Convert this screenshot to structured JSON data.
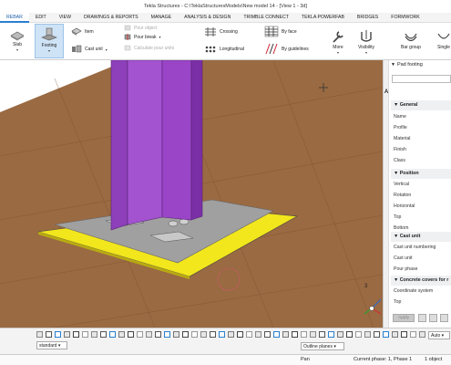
{
  "window": {
    "title": "Tekla Structures - C:\\TeklaStructuresModels\\New model 14  - [View 1 - 3d]"
  },
  "menu": {
    "items": [
      "REBAR",
      "EDIT",
      "VIEW",
      "DRAWINGS & REPORTS",
      "MANAGE",
      "ANALYSIS & DESIGN",
      "TRIMBLE CONNECT",
      "TEKLA POWERFAB",
      "BRIDGES",
      "FORMWORK"
    ],
    "active": "REBAR"
  },
  "ribbon": {
    "slab": "Slab",
    "footing": "Footing",
    "item": "Item",
    "cast_unit": "Cast unit",
    "pour_object": "Pour object",
    "pour_break": "Pour break",
    "calc_pour_units": "Calculate pour units",
    "crossing": "Crossing",
    "longitudinal": "Longitudinal",
    "by_face": "By face",
    "by_guidelines": "By guidelines",
    "more": "More",
    "visibility": "Visibility",
    "bar_group": "Bar group",
    "single": "Single"
  },
  "properties": {
    "object_type": "Pad footing",
    "sections": [
      {
        "title": "General",
        "rows": [
          "Name",
          "Profile",
          "Material",
          "Finish",
          "Class"
        ]
      },
      {
        "title": "Position",
        "rows": [
          "Vertical",
          "Rotation",
          "Horizontal",
          "Top",
          "Bottom"
        ]
      },
      {
        "title": "Cast unit",
        "rows": [
          "Cast unit numbering",
          "Cast unit",
          "Pour phase"
        ]
      },
      {
        "title": "Concrete covers for r",
        "rows": [
          "Coordinate system",
          "Top"
        ]
      }
    ],
    "apply_label": "Apply",
    "side_letter": "A"
  },
  "bottom": {
    "standard": "standard",
    "outline_planes": "Outline planes",
    "auto": "Auto"
  },
  "status": {
    "selection": "Pan",
    "current_phase": "Current phase: 1, Phase 1",
    "objects": "1 object"
  },
  "viewport": {
    "axis_label": "3"
  },
  "colors": {
    "ground": "#9a6a42",
    "column": "#9a45c7",
    "base_plate": "#f2e61c",
    "accent": "#2a7fd0"
  }
}
